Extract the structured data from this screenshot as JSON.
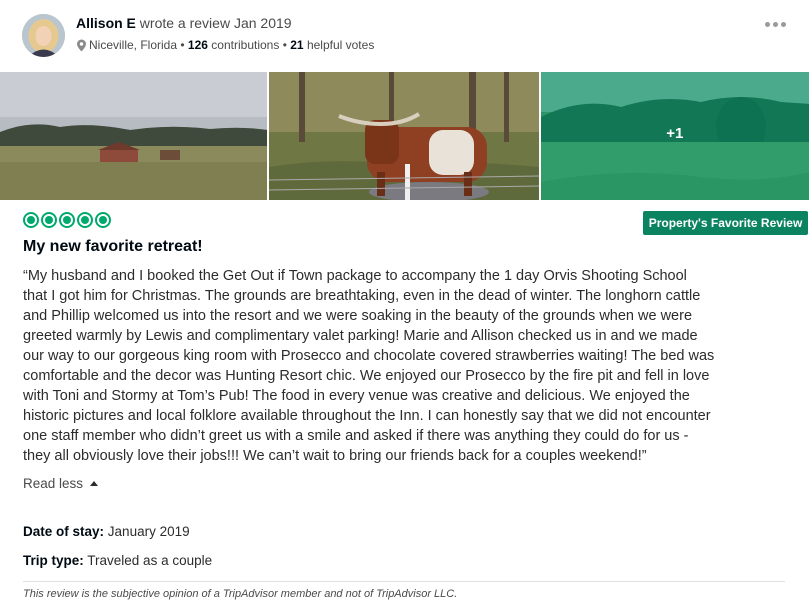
{
  "reviewer": {
    "name": "Allison E",
    "action": "wrote a review",
    "date": "Jan 2019",
    "location": "Niceville, Florida",
    "contributions_count": "126",
    "contributions_label": "contributions",
    "helpful_count": "21",
    "helpful_label": "helpful votes",
    "separator": "•"
  },
  "photos": {
    "extra_count": "+1"
  },
  "review": {
    "rating": 5,
    "badge": "Property's Favorite Review",
    "title": "My new favorite retreat!",
    "body_lines": [
      "“My husband and I booked the Get Out if Town package to accompany the 1 day Orvis Shooting School",
      "that I got him for Christmas. The grounds are breathtaking, even in the dead of winter. The longhorn cattle",
      "and Phillip welcomed us into the resort and we were soaking in the beauty of the grounds when we were",
      "greeted warmly by Lewis and complimentary valet parking! Marie and Allison checked us in and we made",
      "our way to our gorgeous king room with Prosecco and chocolate covered strawberries waiting! The bed was",
      "comfortable and the decor was Hunting Resort chic. We enjoyed our Prosecco by the fire pit and fell in love",
      "with Toni and Stormy at Tom’s Pub! The food in every venue was creative and delicious. We enjoyed the",
      "historic pictures and local folklore available throughout the Inn. I can honestly say that we did not encounter",
      "one staff member who didn’t greet us with a smile and asked if there was anything they could do for us -",
      "they all obviously love their jobs!!! We can’t wait to bring our friends back for a couples weekend!”"
    ],
    "read_less": "Read less",
    "date_of_stay_label": "Date of stay:",
    "date_of_stay": "January 2019",
    "trip_type_label": "Trip type:",
    "trip_type": "Traveled as a couple",
    "disclaimer": "This review is the subjective opinion of a TripAdvisor member and not of TripAdvisor LLC."
  },
  "colors": {
    "bubble": "#00aa6c",
    "badge": "#0b8361",
    "overlay": "#00a078"
  },
  "icons": {
    "location": "map-pin-icon",
    "more": "more-options-icon",
    "read_less": "caret-up-icon",
    "rating": "rating-bubble-icon"
  }
}
